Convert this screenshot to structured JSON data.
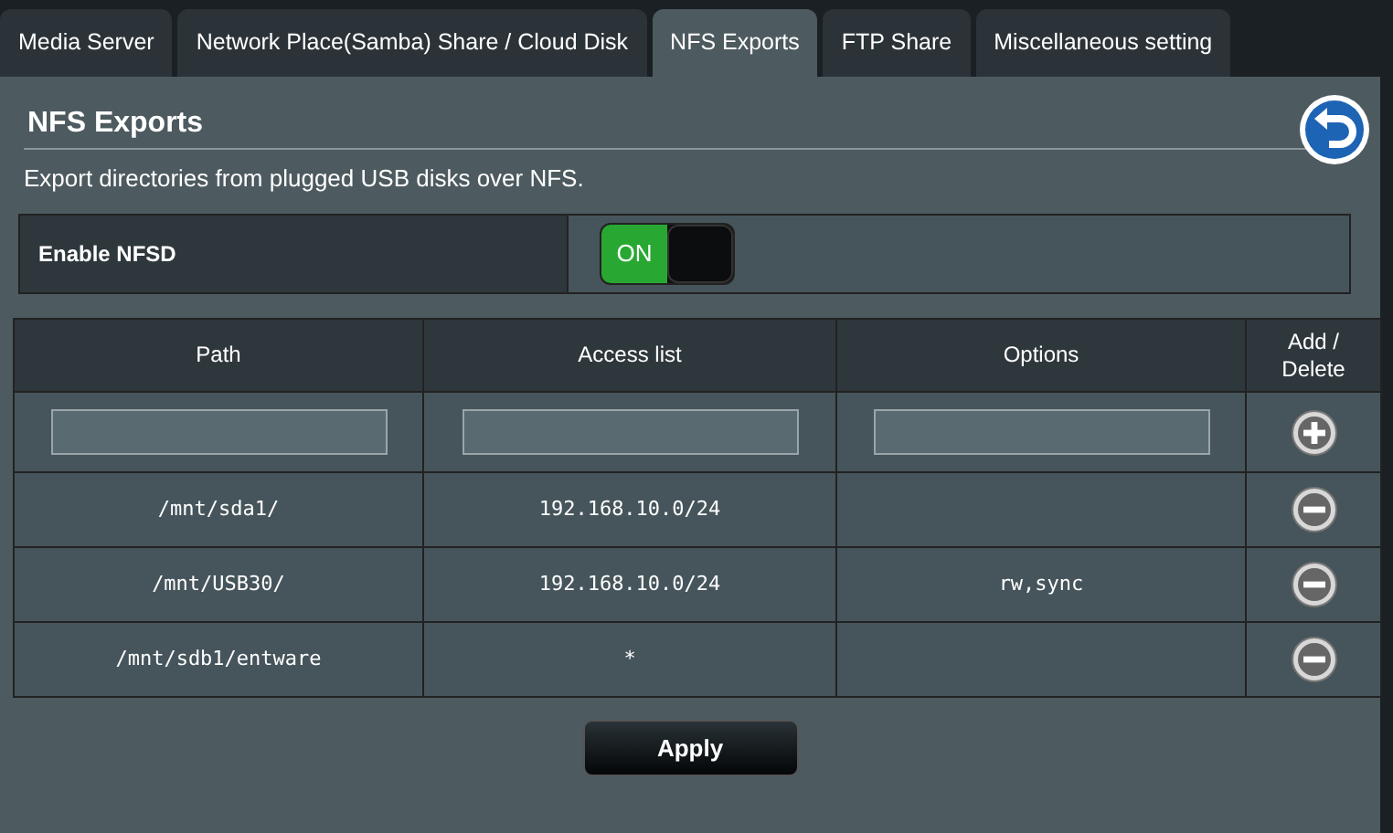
{
  "tabs": [
    {
      "label": "Media Server",
      "selected": false
    },
    {
      "label": "Network Place(Samba) Share / Cloud Disk",
      "selected": false
    },
    {
      "label": "NFS Exports",
      "selected": true
    },
    {
      "label": "FTP Share",
      "selected": false
    },
    {
      "label": "Miscellaneous setting",
      "selected": false
    }
  ],
  "title": "NFS Exports",
  "description": "Export directories from plugged USB disks over NFS.",
  "enable_nfsd": {
    "label": "Enable NFSD",
    "on": true,
    "on_text": "ON"
  },
  "table": {
    "columns": [
      "Path",
      "Access list",
      "Options",
      "Add / Delete"
    ],
    "rows": [
      {
        "path": "/mnt/sda1/",
        "access": "192.168.10.0/24"
      },
      {
        "path": "/mnt/USB30/",
        "access": "192.168.10.0/24",
        "options": "rw,sync"
      },
      {
        "path": "/mnt/sdb1/entware",
        "access": "*"
      }
    ]
  },
  "apply_button": "Apply"
}
